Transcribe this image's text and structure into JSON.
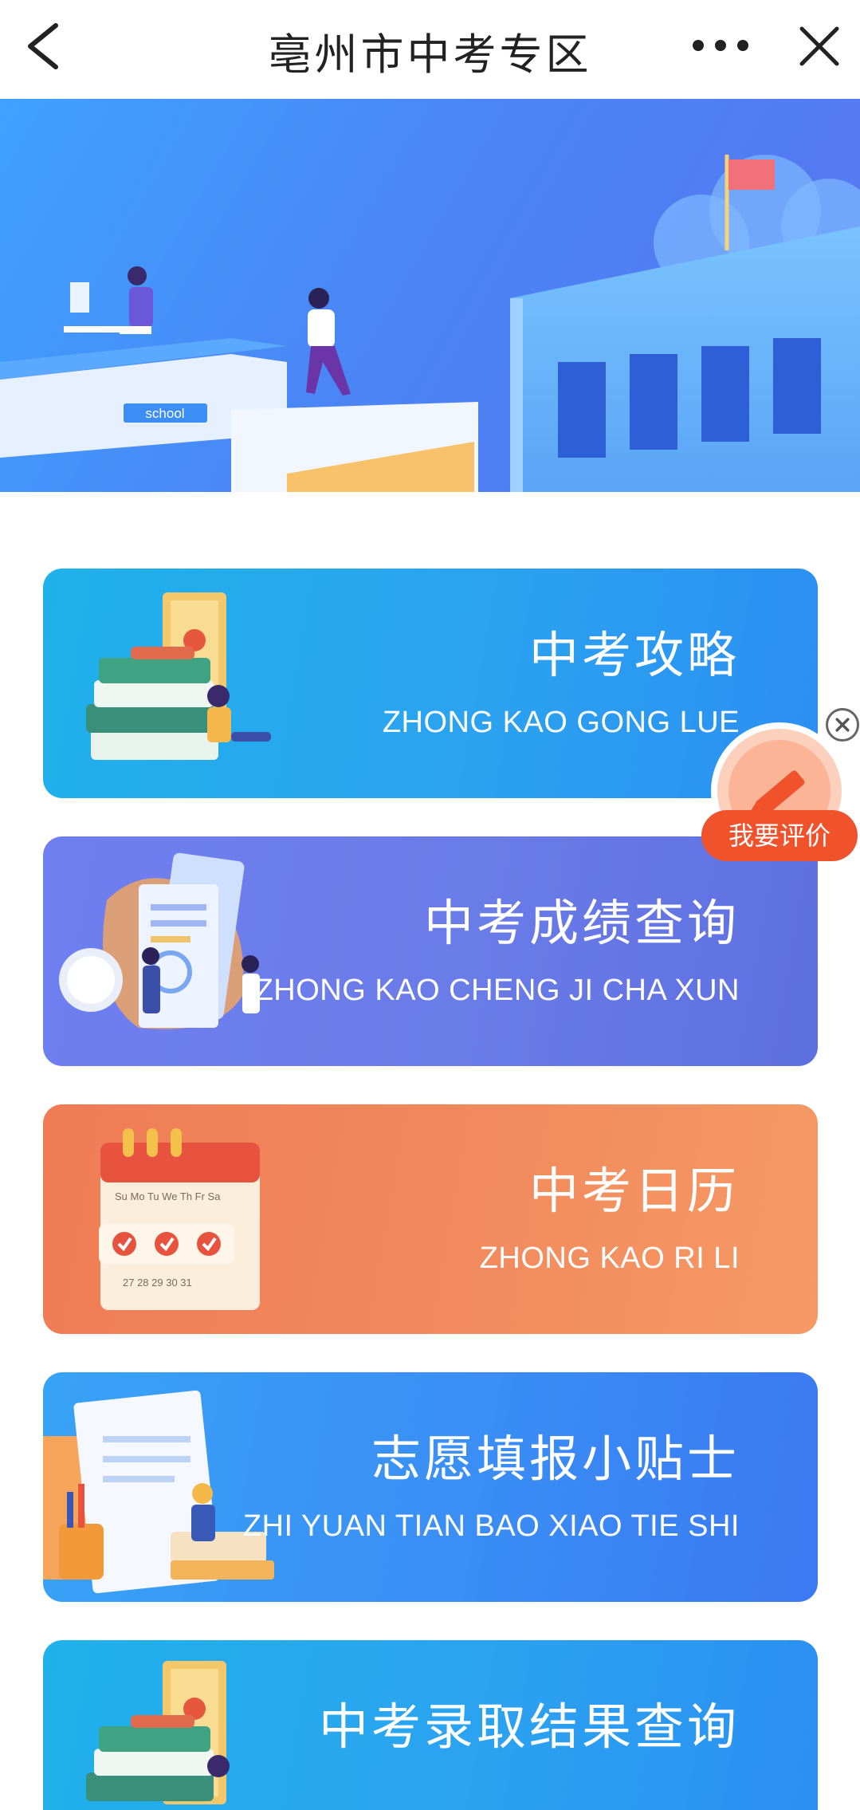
{
  "nav": {
    "title": "亳州市中考专区",
    "back_icon": "chevron-left-icon",
    "more_icon": "more-horizontal-icon",
    "close_icon": "close-icon"
  },
  "banner": {
    "sign_text": "school"
  },
  "cards": [
    {
      "title": "中考攻略",
      "subtitle": "ZHONG KAO GONG LUE",
      "color": "#2ba3f0"
    },
    {
      "title": "中考成绩查询",
      "subtitle": "ZHONG KAO CHENG JI CHA XUN",
      "color": "#6a7ce8"
    },
    {
      "title": "中考日历",
      "subtitle": "ZHONG KAO RI LI",
      "color": "#f28a5d"
    },
    {
      "title": "志愿填报小贴士",
      "subtitle": "ZHI YUAN TIAN BAO XIAO TIE SHI",
      "color": "#3a8ef5"
    },
    {
      "title": "中考录取结果查询",
      "subtitle": "",
      "color": "#2ba3f0"
    }
  ],
  "review_badge": {
    "label": "我要评价",
    "icon": "pencil-icon",
    "close_icon": "close-circle-icon",
    "color": "#f0522c"
  }
}
